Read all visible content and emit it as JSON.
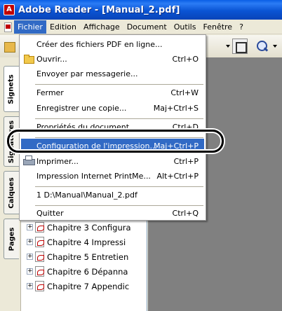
{
  "window": {
    "title": "Adobe Reader - [Manual_2.pdf]",
    "logo_glyph": "A"
  },
  "menubar": {
    "items": [
      {
        "label": "Fichier",
        "active": true
      },
      {
        "label": "Edition"
      },
      {
        "label": "Affichage"
      },
      {
        "label": "Document"
      },
      {
        "label": "Outils"
      },
      {
        "label": "Fenêtre"
      },
      {
        "label": "?"
      }
    ]
  },
  "toolbar": {
    "icons": [
      "open-folder-icon",
      "dropdown-arrow-icon",
      "fit-page-icon",
      "zoom-in-icon",
      "dropdown-arrow-icon"
    ]
  },
  "side_tabs": [
    {
      "label": "Signets",
      "selected": true
    },
    {
      "label": "Signatures"
    },
    {
      "label": "Calques"
    },
    {
      "label": "Pages"
    }
  ],
  "file_menu": {
    "items": [
      {
        "label": "Créer des fichiers PDF en ligne...",
        "shortcut": ""
      },
      {
        "label": "Ouvrir...",
        "shortcut": "Ctrl+O",
        "icon": "open-folder-icon"
      },
      {
        "label": "Envoyer par messagerie...",
        "shortcut": ""
      },
      {
        "label": "Fermer",
        "shortcut": "Ctrl+W"
      },
      {
        "label": "Enregistrer une copie...",
        "shortcut": "Maj+Ctrl+S"
      },
      {
        "label": "Propriétés du document...",
        "shortcut": "Ctrl+D"
      },
      {
        "label": "Configuration de l'impression...",
        "shortcut": "Maj+Ctrl+P",
        "highlighted": true
      },
      {
        "label": "Imprimer...",
        "shortcut": "Ctrl+P",
        "icon": "printer-icon"
      },
      {
        "label": "Impression Internet PrintMe...",
        "shortcut": "Alt+Ctrl+P"
      },
      {
        "label": "1 D:\\Manual\\Manual_2.pdf",
        "shortcut": ""
      },
      {
        "label": "Quitter",
        "shortcut": "Ctrl+Q"
      }
    ]
  },
  "bookmarks": [
    {
      "label": "Chapitre 3 Configura"
    },
    {
      "label": "Chapitre 4 Impressi"
    },
    {
      "label": "Chapitre 5 Entretien"
    },
    {
      "label": "Chapitre 6 Dépanna"
    },
    {
      "label": "Chapitre 7 Appendic"
    }
  ],
  "colors": {
    "titlebar": "#0a54d4",
    "menu_highlight": "#316ac5",
    "chrome": "#ece9d8",
    "doc_background": "#808080"
  }
}
